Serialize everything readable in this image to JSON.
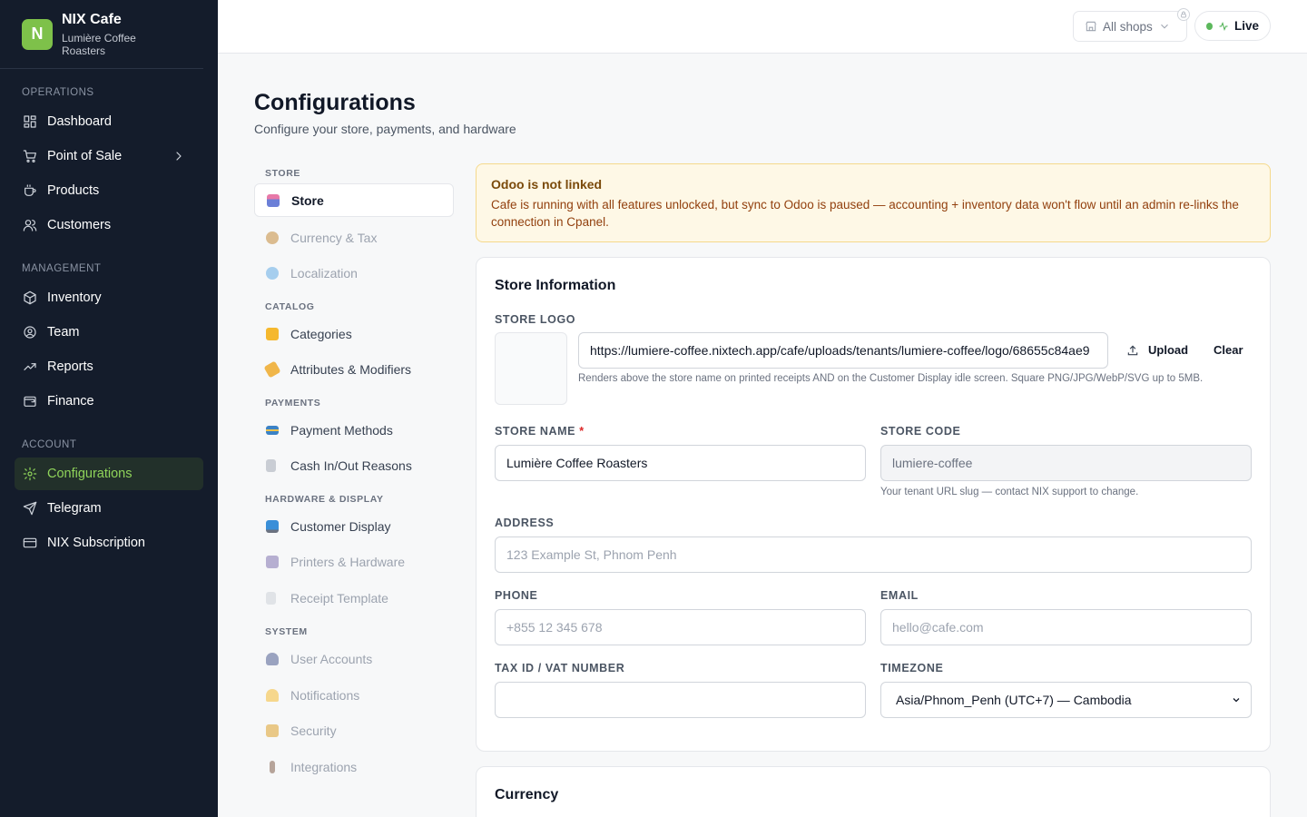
{
  "brand": {
    "initial": "N",
    "name": "NIX Cafe",
    "subtitle": "Lumière Coffee Roasters"
  },
  "sidebar": {
    "sections": [
      {
        "label": "OPERATIONS",
        "items": [
          {
            "label": "Dashboard",
            "icon": "dashboard-icon"
          },
          {
            "label": "Point of Sale",
            "icon": "cart-icon",
            "has_chevron": true
          },
          {
            "label": "Products",
            "icon": "coffee-cup-icon"
          },
          {
            "label": "Customers",
            "icon": "users-icon"
          }
        ]
      },
      {
        "label": "MANAGEMENT",
        "items": [
          {
            "label": "Inventory",
            "icon": "box-icon"
          },
          {
            "label": "Team",
            "icon": "user-circle-icon"
          },
          {
            "label": "Reports",
            "icon": "trend-icon"
          },
          {
            "label": "Finance",
            "icon": "wallet-icon"
          }
        ]
      },
      {
        "label": "ACCOUNT",
        "items": [
          {
            "label": "Configurations",
            "icon": "gear-icon",
            "active": true
          },
          {
            "label": "Telegram",
            "icon": "send-icon"
          },
          {
            "label": "NIX Subscription",
            "icon": "card-icon"
          }
        ]
      }
    ]
  },
  "topbar": {
    "shop_label": "All shops",
    "live_label": "Live",
    "live_color": "#5cb85c"
  },
  "page": {
    "title": "Configurations",
    "subtitle": "Configure your store, payments, and hardware"
  },
  "subnav": {
    "sections": [
      {
        "label": "STORE",
        "items": [
          {
            "label": "Store",
            "active": true
          },
          {
            "label": "Currency & Tax",
            "dim": true
          },
          {
            "label": "Localization",
            "dim": true
          }
        ]
      },
      {
        "label": "CATALOG",
        "items": [
          {
            "label": "Categories"
          },
          {
            "label": "Attributes & Modifiers"
          }
        ]
      },
      {
        "label": "PAYMENTS",
        "items": [
          {
            "label": "Payment Methods"
          },
          {
            "label": "Cash In/Out Reasons"
          }
        ]
      },
      {
        "label": "HARDWARE & DISPLAY",
        "items": [
          {
            "label": "Customer Display"
          },
          {
            "label": "Printers & Hardware",
            "dim": true
          },
          {
            "label": "Receipt Template",
            "dim": true
          }
        ]
      },
      {
        "label": "SYSTEM",
        "items": [
          {
            "label": "User Accounts",
            "dim": true
          },
          {
            "label": "Notifications",
            "dim": true
          },
          {
            "label": "Security",
            "dim": true
          },
          {
            "label": "Integrations",
            "dim": true
          }
        ]
      }
    ]
  },
  "alert": {
    "title": "Odoo is not linked",
    "body": "Cafe is running with all features unlocked, but sync to Odoo is paused — accounting + inventory data won't flow until an admin re-links the connection in Cpanel."
  },
  "store_info": {
    "title": "Store Information",
    "logo_label": "STORE LOGO",
    "logo_url": "https://lumiere-coffee.nixtech.app/cafe/uploads/tenants/lumiere-coffee/logo/68655c84ae9",
    "upload_label": "Upload",
    "clear_label": "Clear",
    "logo_hint": "Renders above the store name on printed receipts AND on the Customer Display idle screen. Square PNG/JPG/WebP/SVG up to 5MB.",
    "name_label": "STORE NAME",
    "name_required": "*",
    "name_value": "Lumière Coffee Roasters",
    "code_label": "STORE CODE",
    "code_value": "lumiere-coffee",
    "code_hint": "Your tenant URL slug — contact NIX support to change.",
    "address_label": "ADDRESS",
    "address_placeholder": "123 Example St, Phnom Penh",
    "phone_label": "PHONE",
    "phone_placeholder": "+855 12 345 678",
    "email_label": "EMAIL",
    "email_placeholder": "hello@cafe.com",
    "tax_label": "TAX ID / VAT NUMBER",
    "tax_value": "",
    "timezone_label": "TIMEZONE",
    "timezone_value": "Asia/Phnom_Penh (UTC+7) — Cambodia"
  },
  "currency": {
    "title": "Currency"
  }
}
